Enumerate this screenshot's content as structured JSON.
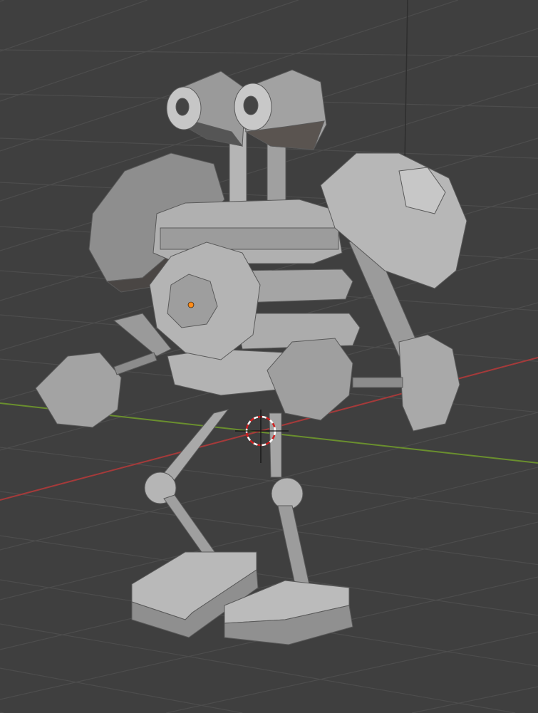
{
  "viewport": {
    "background_color": "#3f3f3f",
    "grid_color": "#4d4d4d",
    "x_axis_color": "#a53a3a",
    "y_axis_color": "#6a8f2e",
    "z_axis_color": "#2f2f2f",
    "object_color": "#a8a8a8",
    "origin_color": "#ff8c1a",
    "cursor_color": "#d02020"
  }
}
